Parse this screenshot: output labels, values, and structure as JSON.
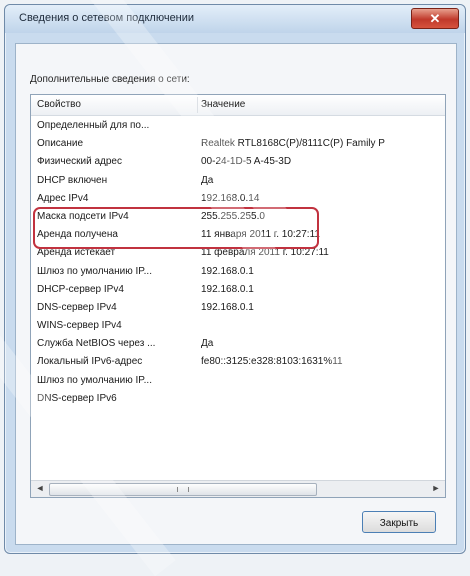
{
  "window": {
    "title": "Сведения о сетевом подключении",
    "close_glyph": "✕"
  },
  "caption": "Дополнительные сведения о сети:",
  "columns": {
    "property": "Свойство",
    "value": "Значение"
  },
  "rows": [
    {
      "property": "Определенный для по...",
      "value": ""
    },
    {
      "property": "Описание",
      "value": "Realtek RTL8168C(P)/8111C(P) Family P"
    },
    {
      "property": "Физический адрес",
      "value": "00-24-1D-5 A-45-3D"
    },
    {
      "property": "DHCP включен",
      "value": "Да"
    },
    {
      "property": "Адрес IPv4",
      "value": "192.168.0.14"
    },
    {
      "property": "Маска подсети IPv4",
      "value": "255.255.255.0"
    },
    {
      "property": "Аренда получена",
      "value": "11 января 2011 г. 10:27:11"
    },
    {
      "property": "Аренда истекает",
      "value": "11 февраля 2011 г. 10:27:11"
    },
    {
      "property": "Шлюз по умолчанию IP...",
      "value": "192.168.0.1"
    },
    {
      "property": "DHCP-сервер IPv4",
      "value": "192.168.0.1"
    },
    {
      "property": "DNS-сервер IPv4",
      "value": "192.168.0.1"
    },
    {
      "property": "WINS-сервер IPv4",
      "value": ""
    },
    {
      "property": "Служба NetBIOS через ...",
      "value": "Да"
    },
    {
      "property": "Локальный IPv6-адрес",
      "value": "fe80::3125:e328:8103:1631%11"
    },
    {
      "property": "Шлюз по умолчанию IP...",
      "value": ""
    },
    {
      "property": "DNS-сервер IPv6",
      "value": ""
    }
  ],
  "scrollbar": {
    "left_arrow": "◄",
    "right_arrow": "►"
  },
  "close_button": "Закрыть",
  "colors": {
    "highlight": "#c1323f",
    "close_button_red": "#c0392b"
  }
}
